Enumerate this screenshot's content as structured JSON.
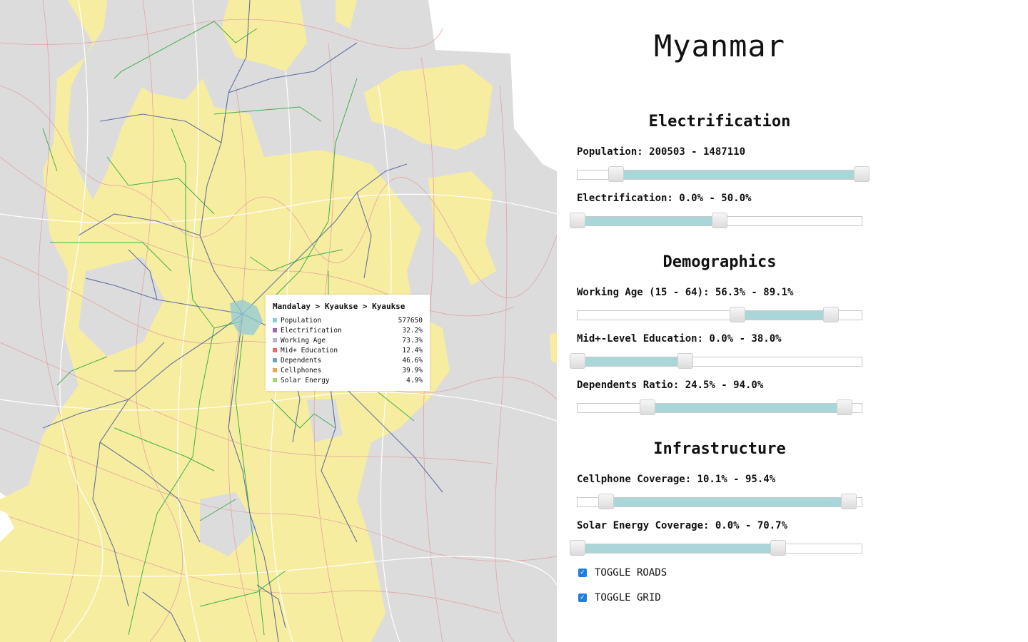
{
  "title": "Myanmar",
  "sections": {
    "electrification": "Electrification",
    "demographics": "Demographics",
    "infrastructure": "Infrastructure"
  },
  "filters": {
    "population": {
      "label": "Population: 200503 - 1487110",
      "min": 200503,
      "max": 1487110,
      "range_start_fraction": 0.135,
      "range_end_fraction": 1.0
    },
    "electrification": {
      "label": "Electrification: 0.0% - 50.0%",
      "min": 0.0,
      "max": 50.0,
      "range_start_fraction": 0.0,
      "range_end_fraction": 0.5
    },
    "working_age": {
      "label": "Working Age (15 - 64): 56.3% - 89.1%",
      "min": 56.3,
      "max": 89.1,
      "range_start_fraction": 0.563,
      "range_end_fraction": 0.891
    },
    "education": {
      "label": "Mid+-Level Education: 0.0% - 38.0%",
      "min": 0.0,
      "max": 38.0,
      "range_start_fraction": 0.0,
      "range_end_fraction": 0.38
    },
    "dependents": {
      "label": "Dependents Ratio: 24.5% - 94.0%",
      "min": 24.5,
      "max": 94.0,
      "range_start_fraction": 0.245,
      "range_end_fraction": 0.94
    },
    "cellphone": {
      "label": "Cellphone Coverage: 10.1% - 95.4%",
      "min": 10.1,
      "max": 95.4,
      "range_start_fraction": 0.101,
      "range_end_fraction": 0.954
    },
    "solar": {
      "label": "Solar Energy Coverage: 0.0% - 70.7%",
      "min": 0.0,
      "max": 70.7,
      "range_start_fraction": 0.0,
      "range_end_fraction": 0.707
    }
  },
  "toggles": {
    "roads": {
      "label": "TOGGLE ROADS",
      "checked": true
    },
    "grid": {
      "label": "TOGGLE GRID",
      "checked": true
    }
  },
  "tooltip": {
    "title": "Mandalay > Kyaukse > Kyaukse",
    "rows": [
      {
        "label": "Population",
        "value": "577650",
        "color": "#8fcfcf"
      },
      {
        "label": "Electrification",
        "value": "32.2%",
        "color": "#a066b8"
      },
      {
        "label": "Working Age",
        "value": "73.3%",
        "color": "#b9b2d9"
      },
      {
        "label": "Mid+ Education",
        "value": "12.4%",
        "color": "#ef6b6b"
      },
      {
        "label": "Dependents",
        "value": "46.6%",
        "color": "#6aa3cf"
      },
      {
        "label": "Cellphones",
        "value": "39.9%",
        "color": "#f0a64f"
      },
      {
        "label": "Solar Energy",
        "value": "4.9%",
        "color": "#a9d36b"
      }
    ]
  },
  "map_colors": {
    "selected_region": "#f7eda0",
    "unselected_region": "#dcdcdc",
    "region_border": "#ffffff",
    "subdivision_border": "#e3a3a3",
    "roads": "#4a5d9a",
    "grid": "#3fb04a",
    "highlight": "#8fc9d6"
  }
}
